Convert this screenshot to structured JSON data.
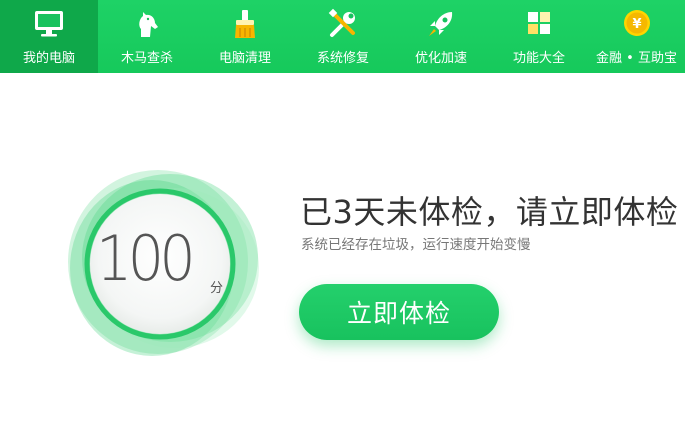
{
  "nav": {
    "tabs": [
      {
        "label": "我的电脑",
        "icon": "monitor-icon",
        "active": true
      },
      {
        "label": "木马查杀",
        "icon": "horse-icon",
        "active": false
      },
      {
        "label": "电脑清理",
        "icon": "broom-icon",
        "active": false
      },
      {
        "label": "系统修复",
        "icon": "wrench-screwdriver-icon",
        "active": false
      },
      {
        "label": "优化加速",
        "icon": "rocket-icon",
        "active": false
      },
      {
        "label": "功能大全",
        "icon": "grid-icon",
        "active": false
      },
      {
        "label": "金融 • 互助宝",
        "icon": "yuan-coin-icon",
        "active": false
      }
    ],
    "coin_symbol": "¥"
  },
  "score": {
    "value": "100",
    "unit": "分"
  },
  "headline": "已3天未体检，请立即体检",
  "subline": "系统已经存在垃圾，运行速度开始变慢",
  "check_button": "立即体检",
  "colors": {
    "brand_green": "#1ed266",
    "active_tab": "#0fa84a",
    "ring_green": "#2ac86a"
  }
}
